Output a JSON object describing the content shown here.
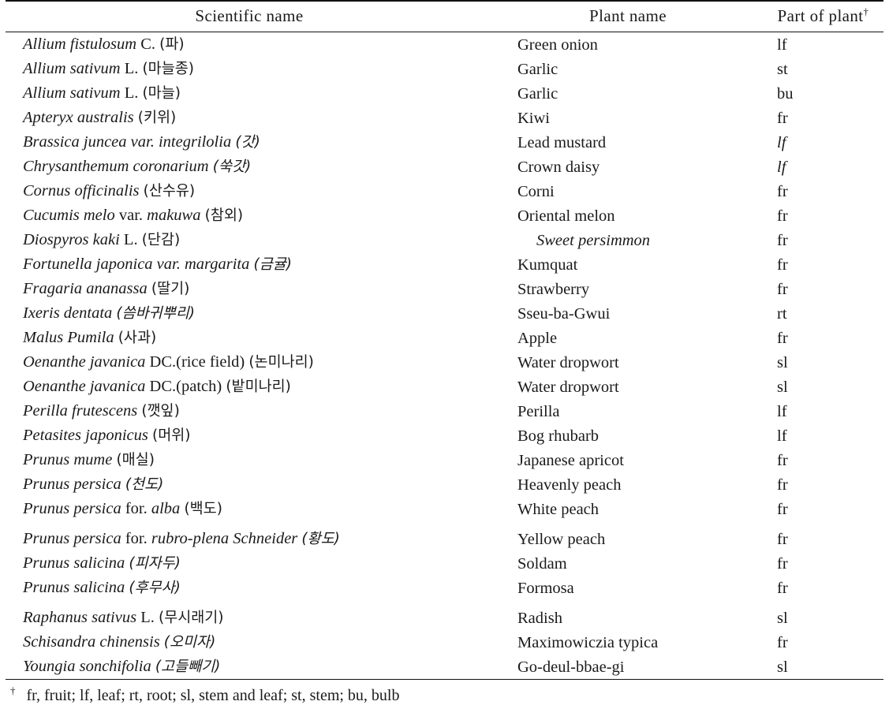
{
  "table": {
    "headers": {
      "scientific_name": "Scientific name",
      "plant_name": "Plant name",
      "part_of_plant": "Part of plant",
      "part_of_plant_marker": "†"
    },
    "rows": [
      {
        "sci_italic_1": "Allium fistulosum",
        "sci_roman": "C.",
        "sci_korean": "(파)",
        "plant": "Green onion",
        "part": "lf"
      },
      {
        "sci_italic_1": "Allium sativum",
        "sci_roman": "L.",
        "sci_korean": "(마늘종)",
        "plant": "Garlic",
        "part": "st"
      },
      {
        "sci_italic_1": "Allium sativum",
        "sci_roman": "L.",
        "sci_korean": "(마늘)",
        "plant": "Garlic",
        "part": "bu"
      },
      {
        "sci_italic_1": "Apteryx australis",
        "sci_roman": "",
        "sci_korean": "(키위)",
        "plant": "Kiwi",
        "part": "fr"
      },
      {
        "sci_italic_1": "Brassica juncea var. integrilolia",
        "sci_roman": "",
        "sci_korean": "(갓)",
        "plant": "Lead mustard",
        "part": "lf"
      },
      {
        "sci_italic_1": "Chrysanthemum coronarium",
        "sci_roman": "",
        "sci_korean": "(쑥갓)",
        "plant": "Crown daisy",
        "part": "lf"
      },
      {
        "sci_italic_1": "Cornus officinalis",
        "sci_roman": "",
        "sci_korean": "(산수유)",
        "plant": "Corni",
        "part": "fr"
      },
      {
        "sci_italic_1": "Cucumis melo",
        "sci_roman": "var.",
        "sci_italic_2": "makuwa",
        "sci_korean": "(참외)",
        "plant": "Oriental melon",
        "part": "fr"
      },
      {
        "sci_italic_1": "Diospyros kaki",
        "sci_roman": "L.",
        "sci_korean": "(단감)",
        "plant": "Sweet persimmon",
        "part": "fr"
      },
      {
        "sci_italic_1": "Fortunella japonica var. margarita",
        "sci_roman": "",
        "sci_korean": "(금귤)",
        "plant": "Kumquat",
        "part": "fr"
      },
      {
        "sci_italic_1": "Fragaria ananassa",
        "sci_roman": "",
        "sci_korean": "(딸기)",
        "plant": "Strawberry",
        "part": "fr"
      },
      {
        "sci_italic_1": "Ixeris dentata",
        "sci_roman": "",
        "sci_korean": "(씀바귀뿌리)",
        "plant": "Sseu-ba-Gwui",
        "part": "rt"
      },
      {
        "sci_italic_1": "Malus Pumila",
        "sci_roman": "",
        "sci_korean": "(사과)",
        "plant": "Apple",
        "part": "fr"
      },
      {
        "sci_italic_1": "Oenanthe javanica",
        "sci_roman": "DC.(rice  field)",
        "sci_korean": "(논미나리)",
        "plant": "Water dropwort",
        "part": "sl"
      },
      {
        "sci_italic_1": "Oenanthe javanica",
        "sci_roman": "DC.(patch)",
        "sci_korean": "(밭미나리)",
        "plant": "Water dropwort",
        "part": "sl"
      },
      {
        "sci_italic_1": "Perilla frutescens",
        "sci_roman": "",
        "sci_korean": "(깻잎)",
        "plant": "Perilla",
        "part": "lf"
      },
      {
        "sci_italic_1": "Petasites japonicus",
        "sci_roman": "",
        "sci_korean": "(머위)",
        "plant": "Bog rhubarb",
        "part": "lf"
      },
      {
        "sci_italic_1": "Prunus mume",
        "sci_roman": "",
        "sci_korean": "(매실)",
        "plant": "Japanese apricot",
        "part": "fr"
      },
      {
        "sci_italic_1": "Prunus persica",
        "sci_roman": "",
        "sci_korean": "(천도)",
        "plant": "Heavenly peach",
        "part": "fr"
      },
      {
        "sci_italic_1": "Prunus persica",
        "sci_roman": "for.",
        "sci_italic_2": "alba",
        "sci_korean": "(백도)",
        "plant": "White peach",
        "part": "fr"
      },
      {
        "sci_italic_1": "Prunus persica",
        "sci_roman": "for.",
        "sci_italic_2": "rubro-plena Schneider",
        "sci_korean": "(황도)",
        "plant": "Yellow peach",
        "part": "fr"
      },
      {
        "sci_italic_1": "Prunus salicina",
        "sci_roman": "",
        "sci_korean": "(피자두)",
        "plant": "Soldam",
        "part": "fr"
      },
      {
        "sci_italic_1": "Prunus salicina",
        "sci_roman": "",
        "sci_korean": "(후무사)",
        "plant": "Formosa",
        "part": "fr"
      },
      {
        "sci_italic_1": "Raphanus sativus",
        "sci_roman": "L.",
        "sci_korean": "(무시래기)",
        "plant": "Radish",
        "part": "sl"
      },
      {
        "sci_italic_1": "Schisandra chinensis",
        "sci_roman": "",
        "sci_korean": "(오미자)",
        "plant": "Maximowiczia typica",
        "part": "fr"
      },
      {
        "sci_italic_1": "Youngia sonchifolia",
        "sci_roman": "",
        "sci_korean": "(고들빼기)",
        "plant": "Go-deul-bbae-gi",
        "part": "sl"
      }
    ]
  },
  "footnote": {
    "marker": "†",
    "text": "fr, fruit; lf, leaf; rt, root; sl, stem and leaf; st, stem; bu, bulb"
  }
}
